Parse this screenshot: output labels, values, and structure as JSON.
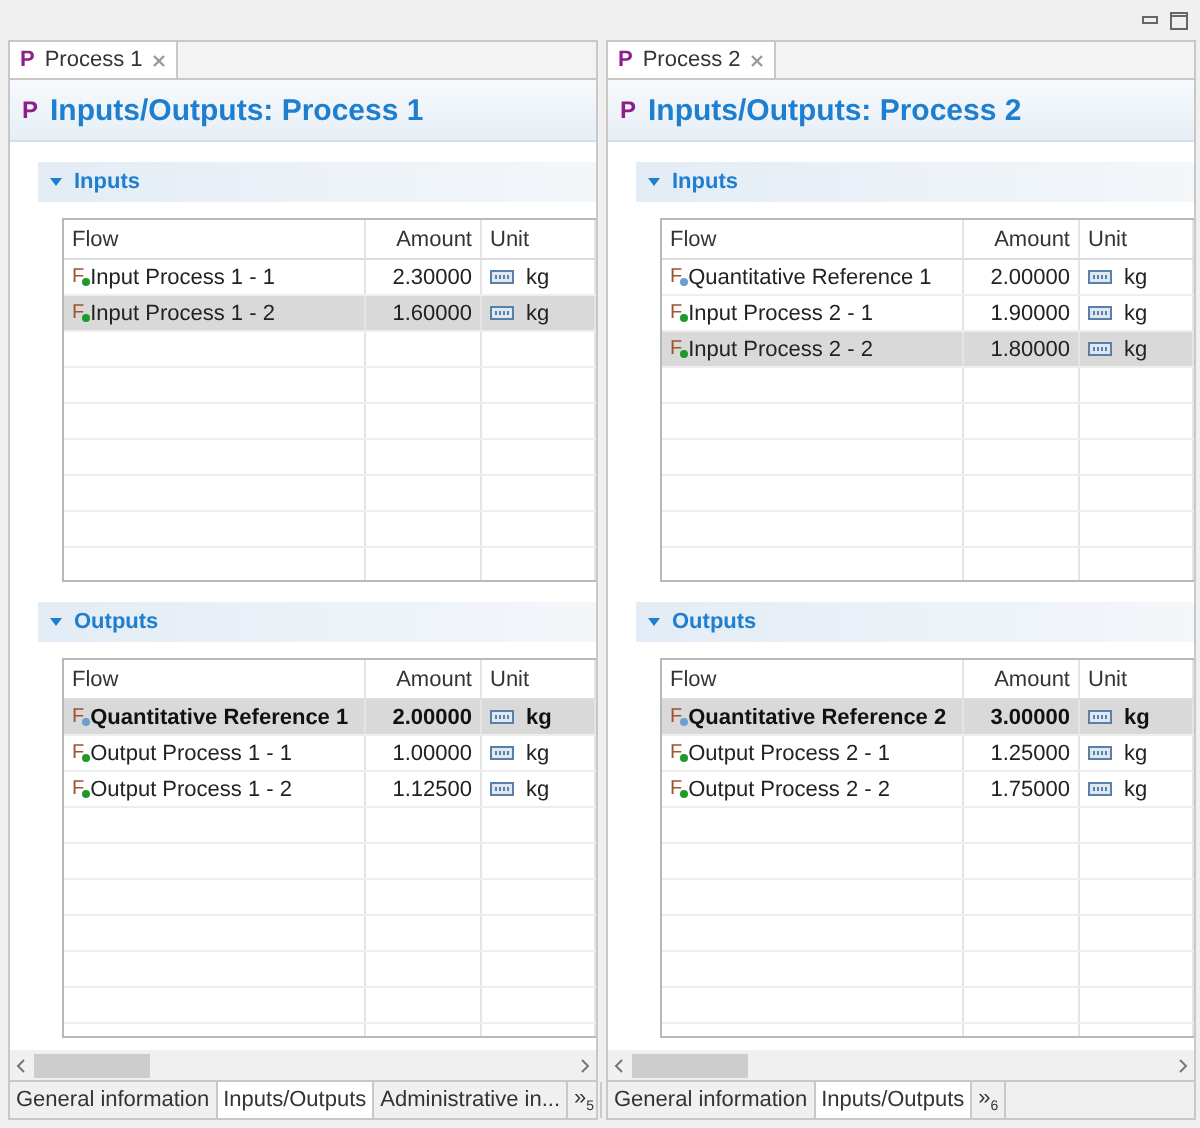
{
  "panels": [
    {
      "tab": {
        "icon": "P",
        "label": "Process 1",
        "selected": true
      },
      "title_icon": "P",
      "title": "Inputs/Outputs: Process 1",
      "sections": [
        {
          "title": "Inputs",
          "expanded": true,
          "columns": [
            "Flow",
            "Amount",
            "Unit"
          ],
          "rows": [
            {
              "kind": "product",
              "icon": "F",
              "flow": "Input Process 1 - 1",
              "amount": "2.30000",
              "unit": "kg",
              "bold": false,
              "selected": false
            },
            {
              "kind": "product",
              "icon": "F",
              "flow": "Input Process 1 - 2",
              "amount": "1.60000",
              "unit": "kg",
              "bold": false,
              "selected": true
            }
          ]
        },
        {
          "title": "Outputs",
          "expanded": true,
          "columns": [
            "Flow",
            "Amount",
            "Unit"
          ],
          "rows": [
            {
              "kind": "reference",
              "icon": "F",
              "flow": "Quantitative Reference 1",
              "amount": "2.00000",
              "unit": "kg",
              "bold": true,
              "selected": true
            },
            {
              "kind": "product",
              "icon": "F",
              "flow": "Output Process 1 - 1",
              "amount": "1.00000",
              "unit": "kg",
              "bold": false,
              "selected": false
            },
            {
              "kind": "product",
              "icon": "F",
              "flow": "Output Process 1 - 2",
              "amount": "1.12500",
              "unit": "kg",
              "bold": false,
              "selected": false
            }
          ]
        }
      ],
      "bottom_tabs": [
        {
          "label": "General information",
          "selected": false
        },
        {
          "label": "Inputs/Outputs",
          "selected": true
        },
        {
          "label": "Administrative in...",
          "selected": false
        },
        {
          "label": "»$_{5}$",
          "selected": false
        }
      ]
    },
    {
      "tab": {
        "icon": "P",
        "label": "Process 2",
        "selected": true
      },
      "title_icon": "P",
      "title": "Inputs/Outputs: Process 2",
      "sections": [
        {
          "title": "Inputs",
          "expanded": true,
          "columns": [
            "Flow",
            "Amount",
            "Unit"
          ],
          "rows": [
            {
              "kind": "reference",
              "icon": "F",
              "flow": "Quantitative Reference 1",
              "amount": "2.00000",
              "unit": "kg",
              "bold": false,
              "selected": false
            },
            {
              "kind": "product",
              "icon": "F",
              "flow": "Input Process 2 - 1",
              "amount": "1.90000",
              "unit": "kg",
              "bold": false,
              "selected": false
            },
            {
              "kind": "product",
              "icon": "F",
              "flow": "Input Process 2 - 2",
              "amount": "1.80000",
              "unit": "kg",
              "bold": false,
              "selected": true
            }
          ]
        },
        {
          "title": "Outputs",
          "expanded": true,
          "columns": [
            "Flow",
            "Amount",
            "Unit"
          ],
          "rows": [
            {
              "kind": "reference",
              "icon": "F",
              "flow": "Quantitative Reference 2",
              "amount": "3.00000",
              "unit": "kg",
              "bold": true,
              "selected": true
            },
            {
              "kind": "product",
              "icon": "F",
              "flow": "Output Process 2 - 1",
              "amount": "1.25000",
              "unit": "kg",
              "bold": false,
              "selected": false
            },
            {
              "kind": "product",
              "icon": "F",
              "flow": "Output Process 2 - 2",
              "amount": "1.75000",
              "unit": "kg",
              "bold": false,
              "selected": false
            }
          ]
        }
      ],
      "bottom_tabs": [
        {
          "label": "General information",
          "selected": false
        },
        {
          "label": "Inputs/Outputs",
          "selected": true
        },
        {
          "label": "»$_{6}$",
          "selected": false
        }
      ]
    }
  ]
}
